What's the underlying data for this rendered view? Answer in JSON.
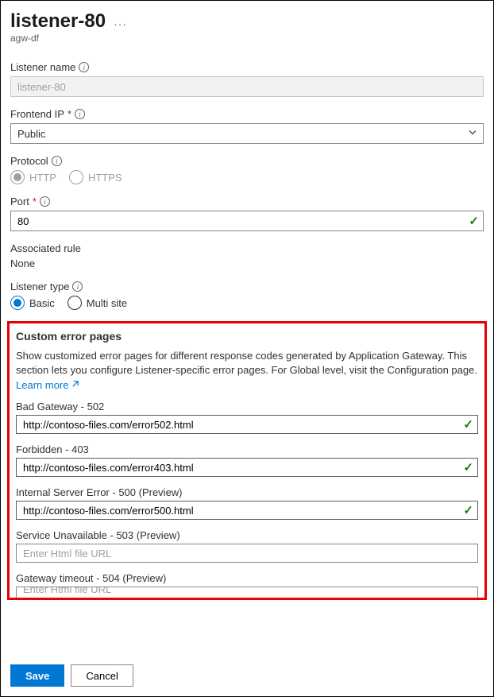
{
  "header": {
    "title": "listener-80",
    "subtitle": "agw-df"
  },
  "listener_name": {
    "label": "Listener name",
    "value": "listener-80"
  },
  "frontend_ip": {
    "label": "Frontend IP",
    "value": "Public"
  },
  "protocol": {
    "label": "Protocol",
    "options": {
      "http": "HTTP",
      "https": "HTTPS"
    },
    "selected": "http"
  },
  "port": {
    "label": "Port",
    "value": "80"
  },
  "associated_rule": {
    "label": "Associated rule",
    "value": "None"
  },
  "listener_type": {
    "label": "Listener type",
    "options": {
      "basic": "Basic",
      "multi": "Multi site"
    },
    "selected": "basic"
  },
  "custom_error": {
    "title": "Custom error pages",
    "description": "Show customized error pages for different response codes generated by Application Gateway. This section lets you configure Listener-specific error pages. For Global level, visit the Configuration page.",
    "learn_more": "Learn more",
    "fields": [
      {
        "label": "Bad Gateway - 502",
        "value": "http://contoso-files.com/error502.html",
        "placeholder": "",
        "valid": true
      },
      {
        "label": "Forbidden - 403",
        "value": "http://contoso-files.com/error403.html",
        "placeholder": "",
        "valid": true
      },
      {
        "label": "Internal Server Error - 500 (Preview)",
        "value": "http://contoso-files.com/error500.html",
        "placeholder": "",
        "valid": true
      },
      {
        "label": "Service Unavailable - 503 (Preview)",
        "value": "",
        "placeholder": "Enter Html file URL",
        "valid": false
      },
      {
        "label": "Gateway timeout - 504 (Preview)",
        "value": "",
        "placeholder": "Enter Html file URL",
        "valid": false
      }
    ]
  },
  "footer": {
    "save": "Save",
    "cancel": "Cancel"
  }
}
